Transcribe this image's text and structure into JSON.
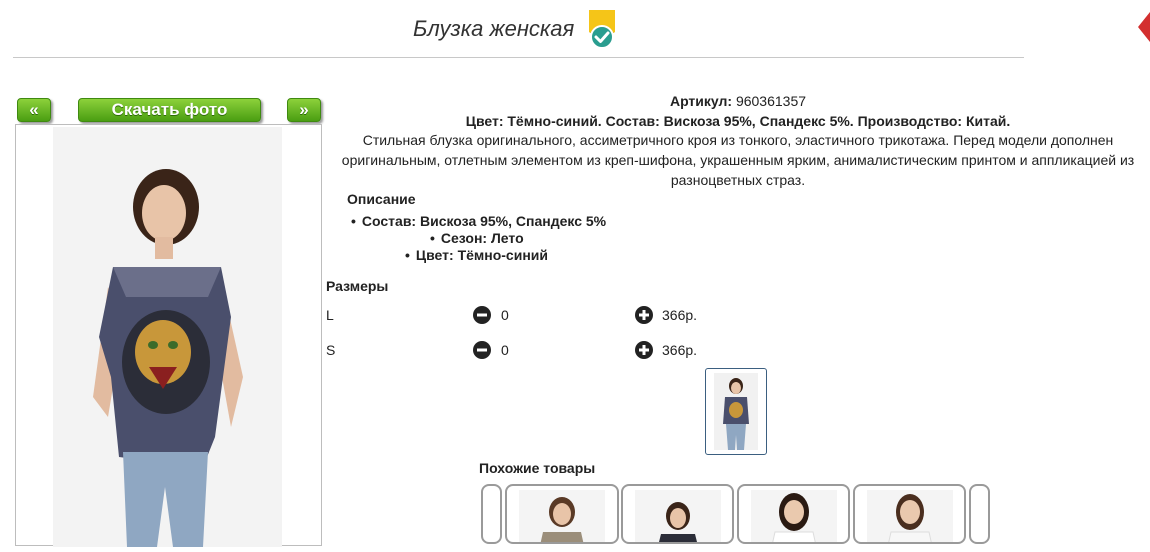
{
  "header": {
    "title": "Блузка женская",
    "badge_icon": "verified-badge-icon",
    "badge_color": "#f5c518",
    "check_color": "#2a9d8f"
  },
  "gallery": {
    "prev_label": "«",
    "download_label": "Скачать фото",
    "next_label": "»",
    "button_color": "#5cb320"
  },
  "product": {
    "article_label": "Артикул:",
    "article_value": "960361357",
    "specs": "Цвет: Тёмно-синий. Состав: Вискоза 95%, Спандекс 5%. Производство: Китай.",
    "description": "Стильная блузка оригинального, ассиметричного кроя из тонкого, эластичного трикотажа. Перед модели дополнен оригинальным, отлетным элементом из креп-шифона, украшенным ярким, анималистическим принтом и аппликацией из разноцветных страз."
  },
  "details": {
    "heading": "Описание",
    "bullets": [
      "Состав: Вискоза 95%, Спандекс 5%",
      "Сезон: Лето",
      "Цвет: Тёмно-синий"
    ]
  },
  "sizes": {
    "heading": "Размеры",
    "rows": [
      {
        "size": "L",
        "qty": "0",
        "price": "366р."
      },
      {
        "size": "S",
        "qty": "0",
        "price": "366р."
      }
    ]
  },
  "similar": {
    "heading": "Похожие товары"
  }
}
